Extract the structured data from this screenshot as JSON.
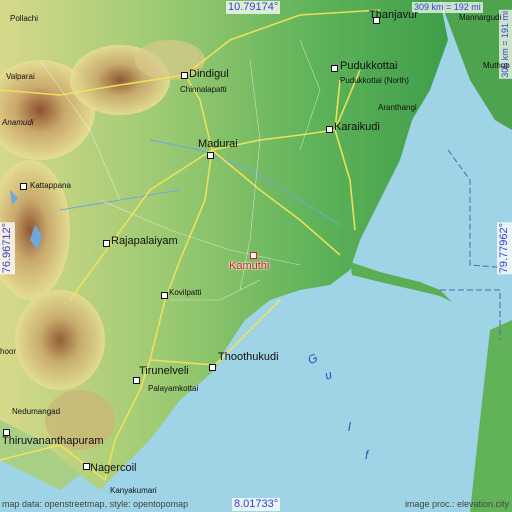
{
  "target": {
    "name": "Kamuthi",
    "color": "#e01b24"
  },
  "coordinates": {
    "top": "10.79174°",
    "bottom": "8.01733°",
    "left": "76.96712°",
    "right": "79.77962°"
  },
  "scale": {
    "horizontal": "309 km = 192 mi",
    "vertical": "308 km = 191 mi"
  },
  "credits": {
    "left": "map data: openstreetmap, style: opentopomap",
    "right": "image proc.: elevation.city"
  },
  "sea_label": [
    "G",
    "u",
    "l",
    "f"
  ],
  "cities": [
    {
      "name": "Pollachi",
      "size": "sm"
    },
    {
      "name": "Thanjavur",
      "size": "big"
    },
    {
      "name": "Mannargudi",
      "size": "sm"
    },
    {
      "name": "Valparai",
      "size": "sm"
    },
    {
      "name": "Dindigul",
      "size": "big"
    },
    {
      "name": "Pudukkottai",
      "size": "big"
    },
    {
      "name": "Pudukkottai (North)",
      "size": "sm"
    },
    {
      "name": "Muthup",
      "size": "sm"
    },
    {
      "name": "Chinnalapatti",
      "size": "sm"
    },
    {
      "name": "Anamudi",
      "size": "sm"
    },
    {
      "name": "Aranthangi",
      "size": "sm"
    },
    {
      "name": "Karaikudi",
      "size": "big"
    },
    {
      "name": "Madurai",
      "size": "big"
    },
    {
      "name": "Kattappana",
      "size": "sm"
    },
    {
      "name": "Rajapalaiyam",
      "size": "big"
    },
    {
      "name": "Kovilpatti",
      "size": "sm"
    },
    {
      "name": "Thoothukudi",
      "size": "big"
    },
    {
      "name": "Tirunelveli",
      "size": "big"
    },
    {
      "name": "Palayamkottai",
      "size": "sm"
    },
    {
      "name": "Nedumangad",
      "size": "sm"
    },
    {
      "name": "Thiruvananthapuram",
      "size": "big"
    },
    {
      "name": "Nagercoil",
      "size": "big"
    },
    {
      "name": "Kanyakumari",
      "size": "sm"
    },
    {
      "name": "hoor",
      "size": "sm"
    }
  ]
}
